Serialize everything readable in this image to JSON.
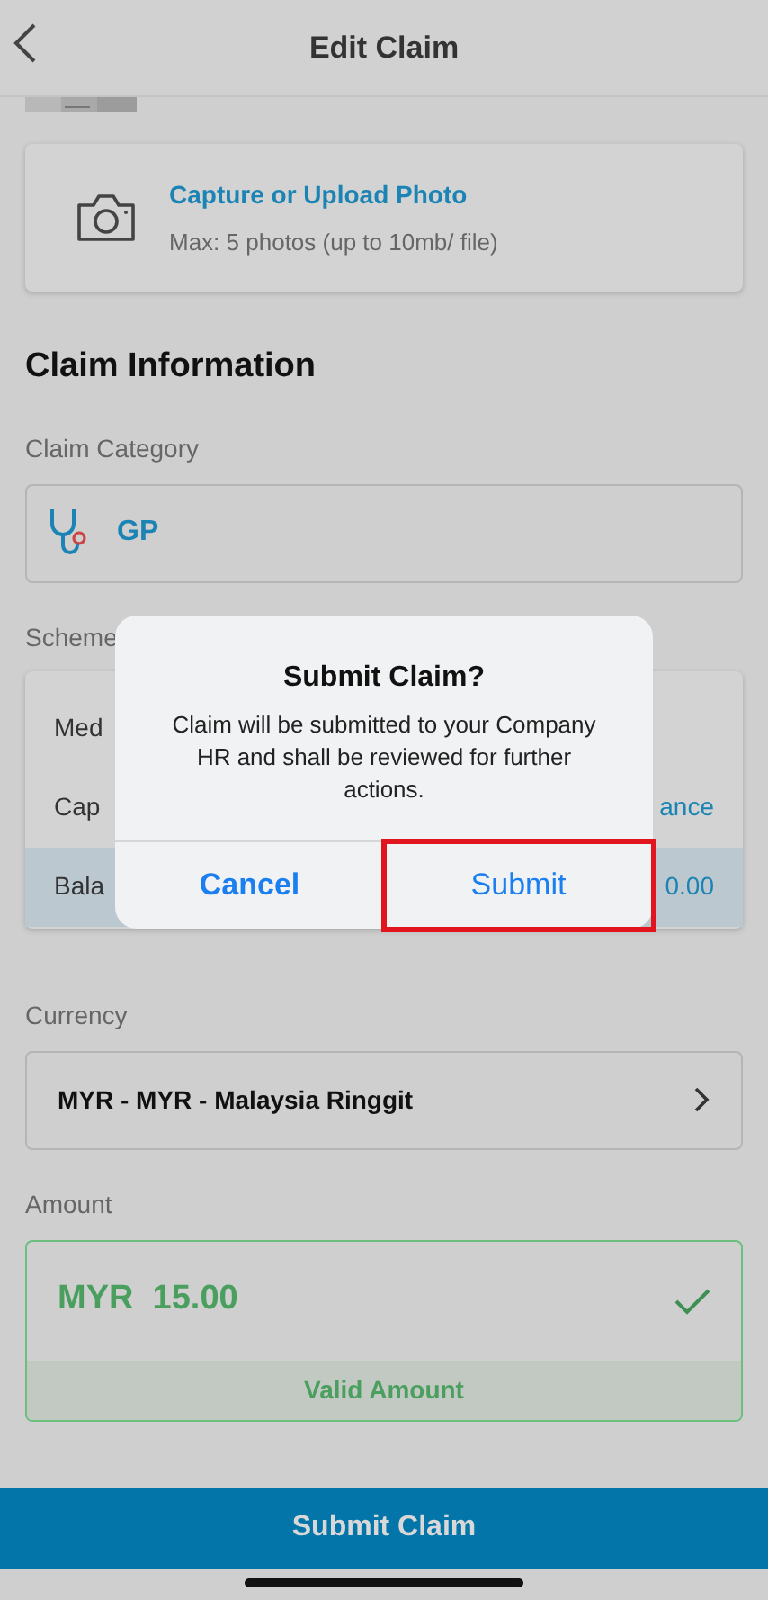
{
  "header": {
    "title": "Edit Claim"
  },
  "upload": {
    "title": "Capture or Upload Photo",
    "hint": "Max: 5 photos (up to 10mb/ file)"
  },
  "section_title": "Claim Information",
  "category": {
    "label": "Claim Category",
    "value": "GP"
  },
  "scheme": {
    "label": "Scheme",
    "rows": [
      {
        "label": "Med",
        "value_text": null,
        "selected": false
      },
      {
        "label": "Cap",
        "value_text": "ance",
        "selected": false
      },
      {
        "label": "Bala",
        "value_text": "0.00",
        "selected": true
      }
    ]
  },
  "currency": {
    "label": "Currency",
    "value": "MYR - MYR - Malaysia Ringgit"
  },
  "amount": {
    "label": "Amount",
    "value": "MYR  15.00",
    "valid": true,
    "message": "Valid Amount"
  },
  "submit_button": "Submit Claim",
  "dialog": {
    "title": "Submit Claim?",
    "message": "Claim will be submitted to your Company HR and shall be reviewed for further actions.",
    "buttons": [
      {
        "label": "Cancel",
        "kind": "cancel",
        "highlighted": false
      },
      {
        "label": "Submit",
        "kind": "confirm",
        "highlighted": true
      }
    ]
  }
}
